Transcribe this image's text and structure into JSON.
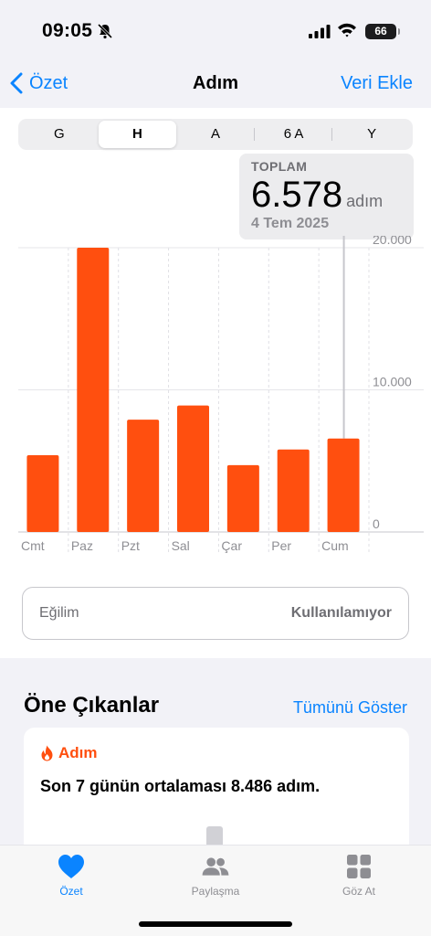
{
  "status_bar": {
    "time": "09:05",
    "battery": "66"
  },
  "nav": {
    "back_label": "Özet",
    "title": "Adım",
    "add_label": "Veri Ekle"
  },
  "segments": [
    "G",
    "H",
    "A",
    "6 A",
    "Y"
  ],
  "selected_segment": "H",
  "callout": {
    "label": "TOPLAM",
    "value": "6.578",
    "unit": "adım",
    "date": "4 Tem 2025"
  },
  "chart_data": {
    "type": "bar",
    "categories": [
      "Cmt",
      "Paz",
      "Pzt",
      "Sal",
      "Çar",
      "Per",
      "Cum"
    ],
    "values": [
      5400,
      20000,
      7900,
      8900,
      4700,
      5800,
      6578
    ],
    "ytick_labels": [
      "20.000",
      "10.000",
      "0"
    ],
    "ylim": [
      0,
      20000
    ],
    "selected_index": 6,
    "bar_color": "#ff4f0f",
    "grid": true
  },
  "trend": {
    "label": "Eğilim",
    "value": "Kullanılamıyor"
  },
  "highlights": {
    "title": "Öne Çıkanlar",
    "show_all": "Tümünü Göster",
    "card": {
      "category": "Adım",
      "message": "Son 7 günün ortalaması 8.486 adım."
    }
  },
  "tabs": [
    {
      "label": "Özet",
      "icon": "heart-icon"
    },
    {
      "label": "Paylaşma",
      "icon": "people-icon"
    },
    {
      "label": "Göz At",
      "icon": "grid-icon"
    }
  ],
  "colors": {
    "accent": "#0a84ff",
    "bar": "#ff4f0f"
  }
}
